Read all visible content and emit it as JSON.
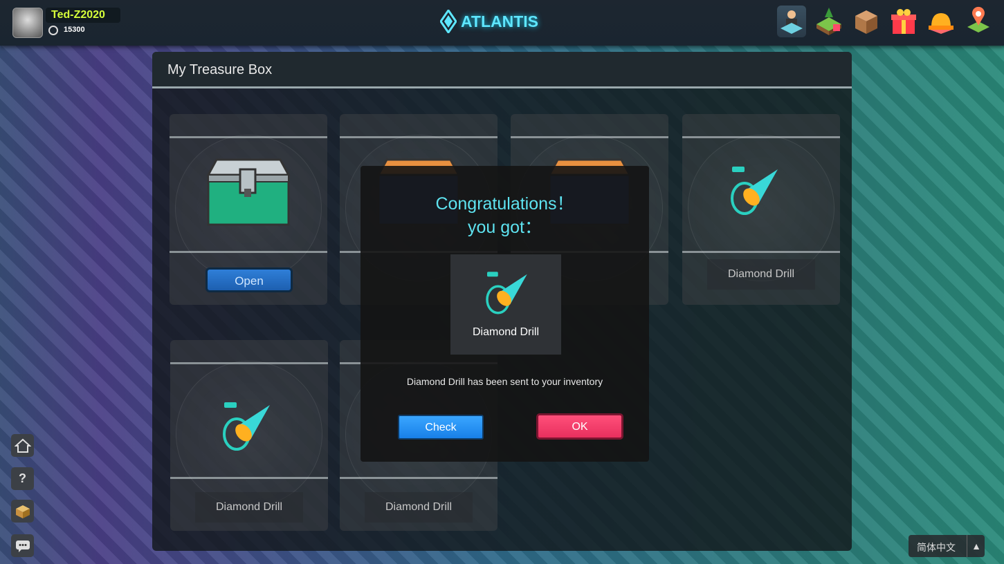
{
  "header": {
    "username": "Ted-Z2020",
    "coins": "15300",
    "game_title": "ATLANTIS",
    "top_icons": [
      "avatar-desk-icon",
      "land-plot-icon",
      "warehouse-icon",
      "gift-icon",
      "hardhat-icon",
      "map-pin-icon"
    ]
  },
  "panel": {
    "title": "My Treasure Box",
    "cards": [
      {
        "type": "chest",
        "button": "Open"
      },
      {
        "type": "chest",
        "button": ""
      },
      {
        "type": "chest",
        "button": ""
      },
      {
        "type": "drill",
        "label": "Diamond Drill"
      },
      {
        "type": "drill",
        "label": "Diamond Drill"
      },
      {
        "type": "drill",
        "label": "Diamond Drill"
      }
    ]
  },
  "modal": {
    "line1": "Congratulations！",
    "line2": "you got：",
    "item_name": "Diamond Drill",
    "message": "Diamond Drill has been sent to your inventory",
    "check_label": "Check",
    "ok_label": "OK"
  },
  "sidebar": {
    "home_icon": "home-icon",
    "help_label": "?",
    "box_icon": "treasure-box-icon",
    "chat_icon": "chat-icon"
  },
  "language": {
    "label": "简体中文",
    "arrow": "▲"
  },
  "colors": {
    "accent": "#5ee3f0",
    "ok": "#ff4f7a",
    "check": "#1880e8",
    "username": "#d6ff3a"
  }
}
